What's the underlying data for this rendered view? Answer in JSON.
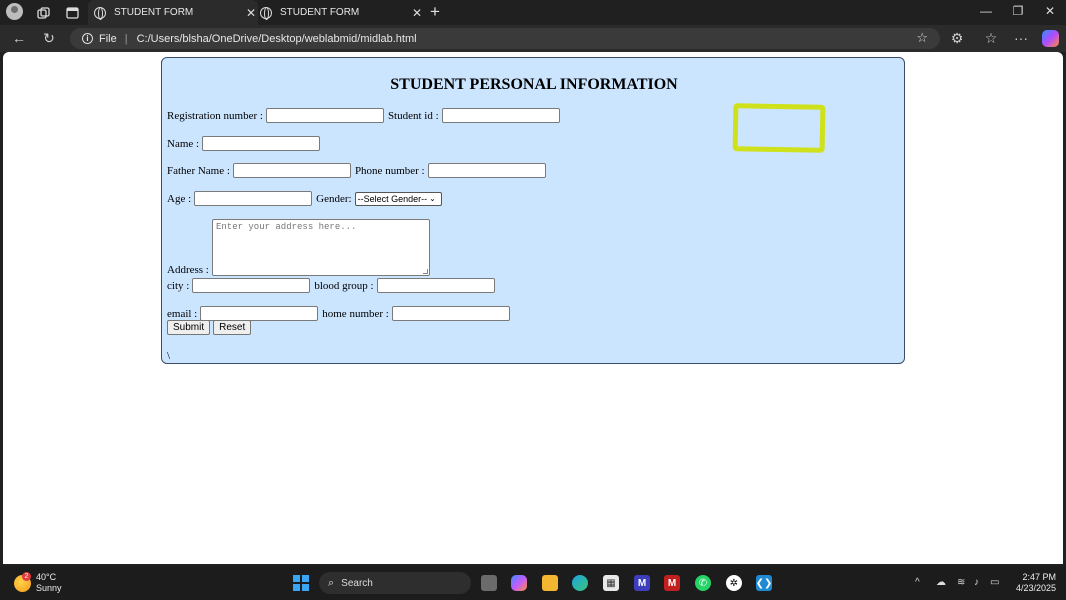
{
  "browser": {
    "tabs": [
      {
        "label": "STUDENT FORM",
        "active": true
      },
      {
        "label": "STUDENT FORM",
        "active": false
      }
    ],
    "address": {
      "scheme_label": "File",
      "url": "C:/Users/blsha/OneDrive/Desktop/weblabmid/midlab.html"
    }
  },
  "form": {
    "title": "STUDENT PERSONAL INFORMATION",
    "labels": {
      "registration": "Registration number :",
      "student_id": "Student id :",
      "name": "Name :",
      "father_name": "Father Name :",
      "phone": "Phone number :",
      "age": "Age :",
      "gender": "Gender:",
      "address": "Address :",
      "city": "city :",
      "blood_group": "blood group :",
      "email": "email :",
      "home_number": "home number :"
    },
    "gender_selected": "--Select Gender--",
    "address_placeholder": "Enter your address here...",
    "submit_label": "Submit",
    "reset_label": "Reset",
    "trailing_text": "\\"
  },
  "taskbar": {
    "weather": {
      "temp": "40°C",
      "condition": "Sunny",
      "badge": "2"
    },
    "search_label": "Search",
    "time": "2:47 PM",
    "date": "4/23/2025"
  },
  "colors": {
    "form_bg": "#cce5ff",
    "highlight": "#cfe11a"
  }
}
